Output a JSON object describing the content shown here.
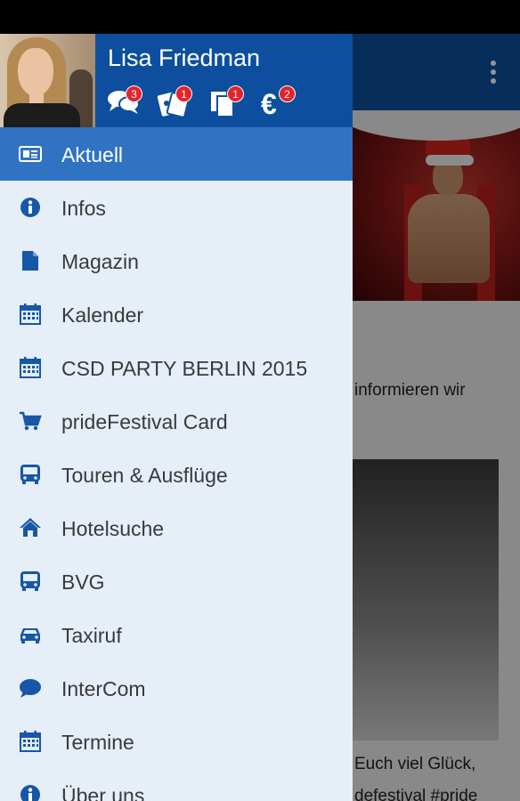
{
  "user": {
    "name": "Lisa Friedman"
  },
  "header_icons": [
    {
      "icon": "chat-icon",
      "badge": "3"
    },
    {
      "icon": "tickets-icon",
      "badge": "1"
    },
    {
      "icon": "documents-icon",
      "badge": "1"
    },
    {
      "icon": "euro-icon",
      "badge": "2"
    }
  ],
  "menu": [
    {
      "label": "Aktuell",
      "icon": "newspaper-icon",
      "active": true
    },
    {
      "label": "Infos",
      "icon": "info-icon"
    },
    {
      "label": "Magazin",
      "icon": "document-icon"
    },
    {
      "label": "Kalender",
      "icon": "calendar-icon"
    },
    {
      "label": "CSD PARTY BERLIN 2015",
      "icon": "calendar-icon"
    },
    {
      "label": "prideFestival Card",
      "icon": "cart-icon"
    },
    {
      "label": "Touren & Ausflüge",
      "icon": "bus-icon"
    },
    {
      "label": "Hotelsuche",
      "icon": "home-icon"
    },
    {
      "label": "BVG",
      "icon": "bus-icon"
    },
    {
      "label": "Taxiruf",
      "icon": "car-icon"
    },
    {
      "label": "InterCom",
      "icon": "speech-bubble-icon"
    },
    {
      "label": "Termine",
      "icon": "calendar-icon"
    },
    {
      "label": "Über uns",
      "icon": "info-icon"
    }
  ],
  "background": {
    "text_line_1": "informieren wir",
    "text_line_2": "Euch viel Glück,",
    "text_line_3": "defestival #pride"
  },
  "colors": {
    "primary": "#0d4f9e",
    "active_item": "#2f73c2",
    "drawer_bg": "#e6eef8",
    "badge": "#e3242b",
    "icon": "#1657a8"
  }
}
